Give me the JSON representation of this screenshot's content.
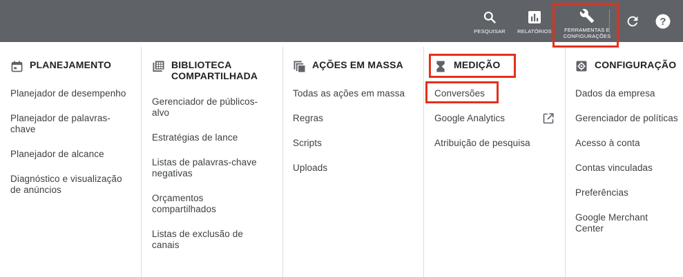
{
  "topbar": {
    "search_label": "PESQUISAR",
    "reports_label": "RELATÓRIOS",
    "tools_label": "FERRAMENTAS E\nCONFIGURAÇÕES"
  },
  "columns": [
    {
      "title": "PLANEJAMENTO",
      "icon": "calendar-icon",
      "items": [
        "Planejador de desempenho",
        "Planejador de palavras-chave",
        "Planejador de alcance",
        "Diagnóstico e visualização de anúncios"
      ]
    },
    {
      "title": "BIBLIOTECA COMPARTILHADA",
      "icon": "library-icon",
      "items": [
        "Gerenciador de públicos-alvo",
        "Estratégias de lance",
        "Listas de palavras-chave negativas",
        "Orçamentos compartilhados",
        "Listas de exclusão de canais"
      ]
    },
    {
      "title": "AÇÕES EM MASSA",
      "icon": "copy-stack-icon",
      "items": [
        "Todas as ações em massa",
        "Regras",
        "Scripts",
        "Uploads"
      ]
    },
    {
      "title": "MEDIÇÃO",
      "icon": "hourglass-icon",
      "items": [
        "Conversões",
        "Google Analytics",
        "Atribuição de pesquisa"
      ]
    },
    {
      "title": "CONFIGURAÇÃO",
      "icon": "settings-box-icon",
      "items": [
        "Dados da empresa",
        "Gerenciador de políticas",
        "Acesso à conta",
        "Contas vinculadas",
        "Preferências",
        "Google Merchant Center"
      ]
    }
  ],
  "colors": {
    "topbar": "#5f6368",
    "highlight": "#e4301b",
    "text": "#3c4043",
    "heading": "#202124"
  }
}
